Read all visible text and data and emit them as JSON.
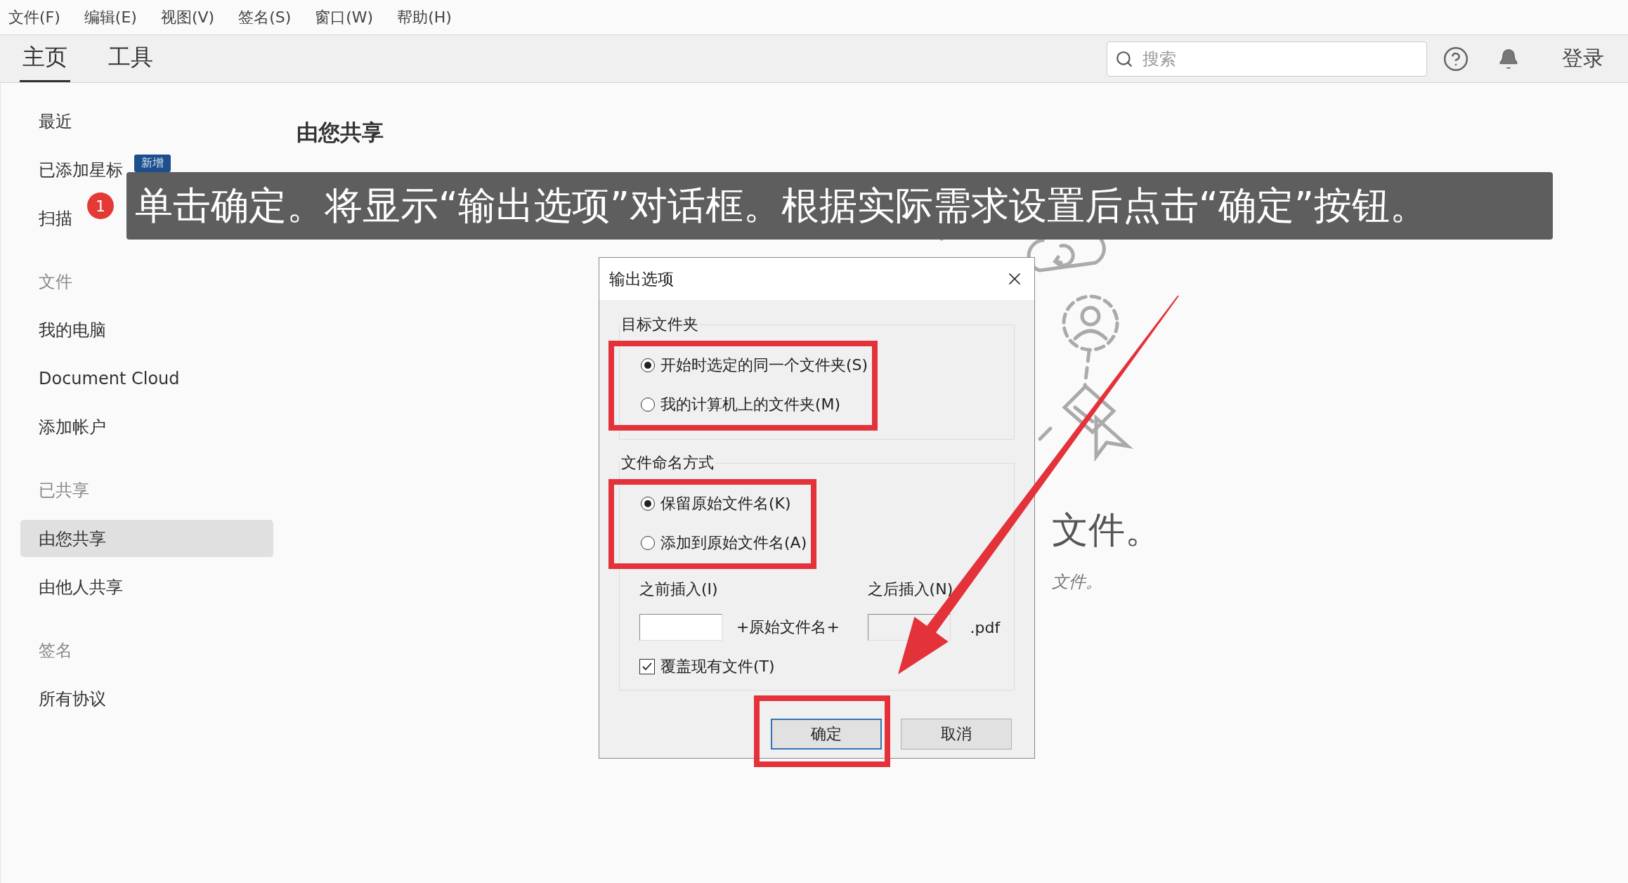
{
  "menu_bar": [
    "文件(F)",
    "编辑(E)",
    "视图(V)",
    "签名(S)",
    "窗口(W)",
    "帮助(H)"
  ],
  "toolbar": {
    "tabs": [
      {
        "label": "主页",
        "selected": true
      },
      {
        "label": "工具",
        "selected": false
      }
    ],
    "search": {
      "placeholder": "搜索"
    },
    "sign_in": "登录"
  },
  "sidebar": {
    "items": [
      {
        "kind": "item",
        "label": "最近",
        "selected": false
      },
      {
        "kind": "item",
        "label": "已添加星标",
        "badge": "新增",
        "selected": false
      },
      {
        "kind": "item",
        "label": "扫描",
        "selected": false
      },
      {
        "kind": "header",
        "label": "文件"
      },
      {
        "kind": "item",
        "label": "我的电脑",
        "selected": false
      },
      {
        "kind": "item",
        "label": "Document Cloud",
        "selected": false
      },
      {
        "kind": "item",
        "label": "添加帐户",
        "selected": false
      },
      {
        "kind": "header",
        "label": "已共享"
      },
      {
        "kind": "item",
        "label": "由您共享",
        "selected": true
      },
      {
        "kind": "item",
        "label": "由他人共享",
        "selected": false
      },
      {
        "kind": "header",
        "label": "签名"
      },
      {
        "kind": "item",
        "label": "所有协议",
        "selected": false
      }
    ]
  },
  "main": {
    "heading": "由您共享",
    "empty_title": "文件。",
    "empty_hint": "文件。"
  },
  "caption": {
    "step": "1",
    "text": "单击确定。将显示“输出选项”对话框。根据实际需求设置后点击“确定”按钮。"
  },
  "dialog": {
    "title": "输出选项",
    "groups": [
      {
        "title": "目标文件夹",
        "highlighted": true,
        "options": [
          {
            "label": "开始时选定的同一个文件夹(S)",
            "selected": true
          },
          {
            "label": "我的计算机上的文件夹(M)",
            "selected": false
          }
        ]
      },
      {
        "title": "文件命名方式",
        "highlighted": true,
        "options": [
          {
            "label": "保留原始文件名(K)",
            "selected": true
          },
          {
            "label": "添加到原始文件名(A)",
            "selected": false
          }
        ]
      }
    ],
    "insert": {
      "before_label": "之前插入(I)",
      "after_label": "之后插入(N)",
      "middle": "+原始文件名+",
      "extension": ".pdf"
    },
    "overwrite": {
      "label": "覆盖现有文件(T)",
      "checked": true
    },
    "buttons": [
      {
        "label": "确定",
        "kind": "default",
        "highlighted": true
      },
      {
        "label": "取消",
        "kind": "normal"
      }
    ]
  }
}
